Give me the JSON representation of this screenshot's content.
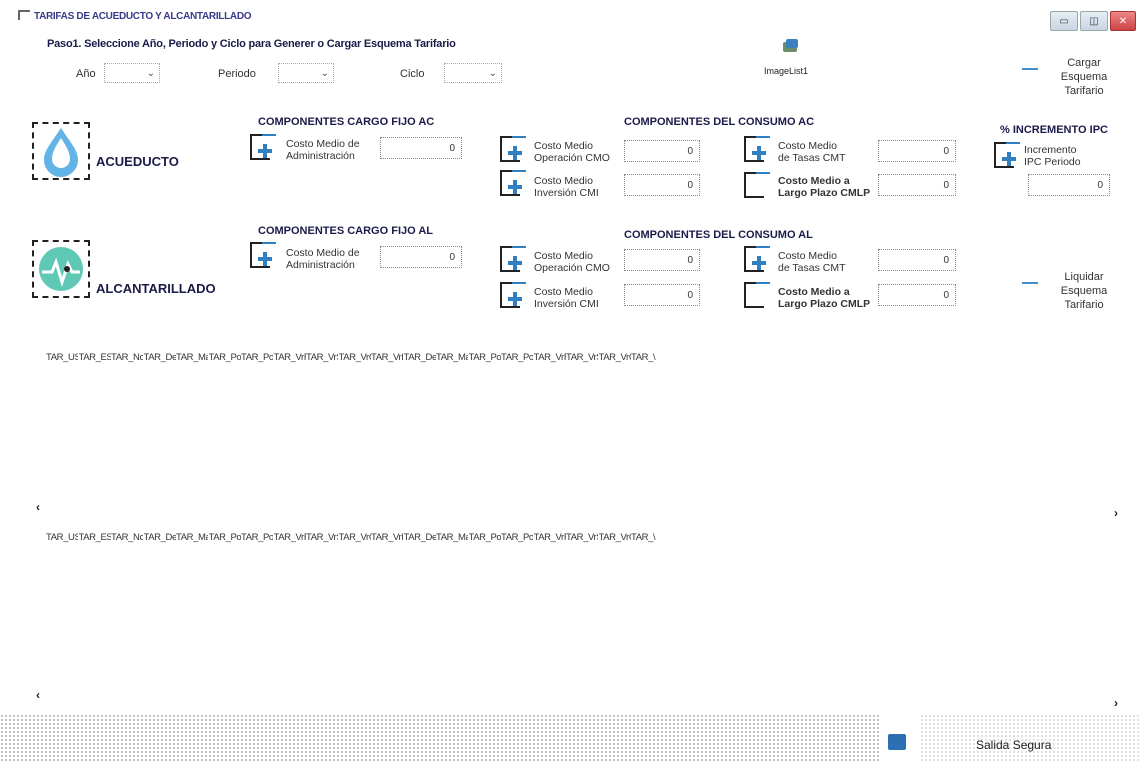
{
  "window": {
    "title": "TARIFAS DE ACUEDUCTO Y ALCANTARILLADO",
    "minimize_label": "▭",
    "maximize_label": "◫",
    "close_label": "✕"
  },
  "step": {
    "label": "Paso1.  Seleccione Año, Periodo y Ciclo para Generer o Cargar Esquema Tarifario",
    "year_label": "Año",
    "period_label": "Periodo",
    "cycle_label": "Ciclo",
    "year_value": "",
    "period_value": "",
    "cycle_value": ""
  },
  "image_list_label": "ImageList1",
  "load_button": {
    "label": "Cargar\nEsquema\nTarifario"
  },
  "liquidate_button": {
    "label": "Liquidar\nEsquema\nTarifario"
  },
  "acueducto": {
    "label": "ACUEDUCTO",
    "cargo_fijo_title": "COMPONENTES CARGO FIJO AC",
    "consumo_title": "COMPONENTES DEL CONSUMO AC",
    "cma_label": "Costo Medio de\nAdministración",
    "cma_value": "0",
    "cmo_label": "Costo Medio\nOperación CMO",
    "cmo_value": "0",
    "cmi_label": "Costo Medio\nInversión CMI",
    "cmi_value": "0",
    "cmt_label": "Costo Medio\nde Tasas CMT",
    "cmt_value": "0",
    "cmlp_label": "Costo Medio a\nLargo Plazo CMLP",
    "cmlp_value": "0"
  },
  "ipc": {
    "title": "% INCREMENTO IPC",
    "label": "Incremento\nIPC Periodo",
    "value": "0"
  },
  "alcantarillado": {
    "label": "ALCANTARILLADO",
    "cargo_fijo_title": "COMPONENTES CARGO FIJO AL",
    "consumo_title": "COMPONENTES DEL CONSUMO AL",
    "cma_label": "Costo Medio de\nAdministración",
    "cma_value": "0",
    "cmo_label": "Costo Medio\nOperación CMO",
    "cmo_value": "0",
    "cmi_label": "Costo Medio\nInversión CMI",
    "cmi_value": "0",
    "cmt_label": "Costo Medio\nde Tasas CMT",
    "cmt_value": "0",
    "cmlp_label": "Costo Medio a\nLargo Plazo CMLP",
    "cmlp_value": "0"
  },
  "grid_columns": [
    "TAR_USO_C",
    "TAR_EST_C",
    "TAR_Nomb",
    "TAR_Descri",
    "TAR_MaxCc",
    "TAR_PorcSu",
    "TAR_PorcCr",
    "TAR_VrReal",
    "TAR_VrSubs",
    "TAR_VrCon",
    "TAR_VrPlen",
    "TAR_Descri",
    "TAR_MaxCc",
    "TAR_PorcSu",
    "TAR_PorcCr",
    "TAR_VrReal",
    "TAR_VrSubs",
    "TAR_VrCon",
    "TAR_\\"
  ],
  "grid_columns_2": [
    "TAR_USO_C",
    "TAR_EST_C",
    "TAR_Nomb",
    "TAR_Descri",
    "TAR_MaxCc",
    "TAR_PorcSu",
    "TAR_PorcCr",
    "TAR_VrReal",
    "TAR_VrSubs",
    "TAR_VrCon",
    "TAR_VrPlen",
    "TAR_Descri",
    "TAR_MaxCc",
    "TAR_PorcSu",
    "TAR_PorcCr",
    "TAR_VrReal",
    "TAR_VrSubs",
    "TAR_VrCon",
    "TAR_\\"
  ],
  "scroll_left": "‹",
  "scroll_right": "›",
  "exit_button": {
    "label": "Salida Segura"
  },
  "colors": {
    "accent": "#2f7fc1",
    "title_text": "#1b1b4a",
    "water_drop": "#62b3e6",
    "sewer_icon": "#5fc9b6"
  }
}
